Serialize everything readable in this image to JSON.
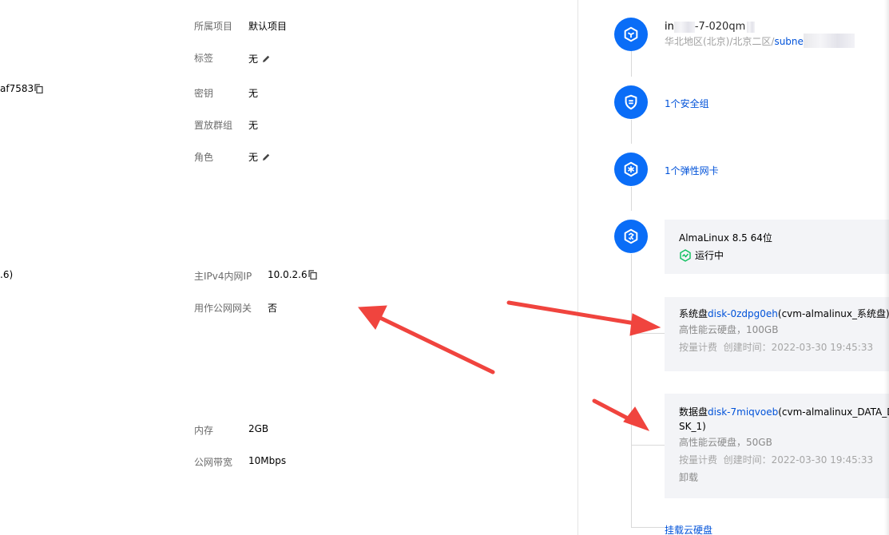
{
  "left_fragments": {
    "id_suffix": "af7583",
    "ip_suffix": ".6)"
  },
  "fields": {
    "project": {
      "label": "所属项目",
      "value": "默认项目"
    },
    "tags": {
      "label": "标签",
      "value": "无"
    },
    "keys": {
      "label": "密钥",
      "value": "无"
    },
    "placement_group": {
      "label": "置放群组",
      "value": "无"
    },
    "role": {
      "label": "角色",
      "value": "无"
    },
    "private_ip": {
      "label": "主IPv4内网IP",
      "value": "10.0.2.6"
    },
    "public_gateway": {
      "label": "用作公网网关",
      "value": "否"
    },
    "memory": {
      "label": "内存",
      "value": "2GB"
    },
    "bandwidth": {
      "label": "公网带宽",
      "value": "10Mbps"
    }
  },
  "topology": {
    "vpc": {
      "name_prefix": "in",
      "name_visible": "-7-020qm",
      "region": "华北地区(北京)/北京二区/",
      "subnet_link": "subne"
    },
    "security_group": {
      "label": "1个安全组"
    },
    "eni": {
      "label": "1个弹性网卡"
    },
    "os": {
      "name": "AlmaLinux 8.5 64位",
      "status": "运行中"
    },
    "system_disk": {
      "prefix": "系统盘",
      "disk_id": "disk-0zdpg0eh",
      "suffix": "(cvm-almalinux_系统盘)",
      "type": "高性能云硬盘，100GB",
      "billing": "按量计费",
      "created": "创建时间：2022-03-30 19:45:33"
    },
    "data_disk": {
      "prefix": "数据盘",
      "disk_id": "disk-7miqvoeb",
      "suffix_line1": "(cvm-almalinux_DATA_DI",
      "suffix_line2": "SK_1)",
      "type": "高性能云硬盘，50GB",
      "billing": "按量计费",
      "created": "创建时间：2022-03-30 19:45:33",
      "unmount": "卸载"
    },
    "mount_disk": {
      "label": "挂载云硬盘"
    }
  },
  "colors": {
    "accent": "#0a6df7",
    "link": "#0052d9",
    "status_green": "#0abf5b",
    "annotation_arrow": "#f0443e"
  },
  "icons": [
    "copy-icon",
    "edit-icon",
    "vpc-cube-icon",
    "shield-icon",
    "network-card-icon",
    "os-icon",
    "running-status-icon"
  ]
}
